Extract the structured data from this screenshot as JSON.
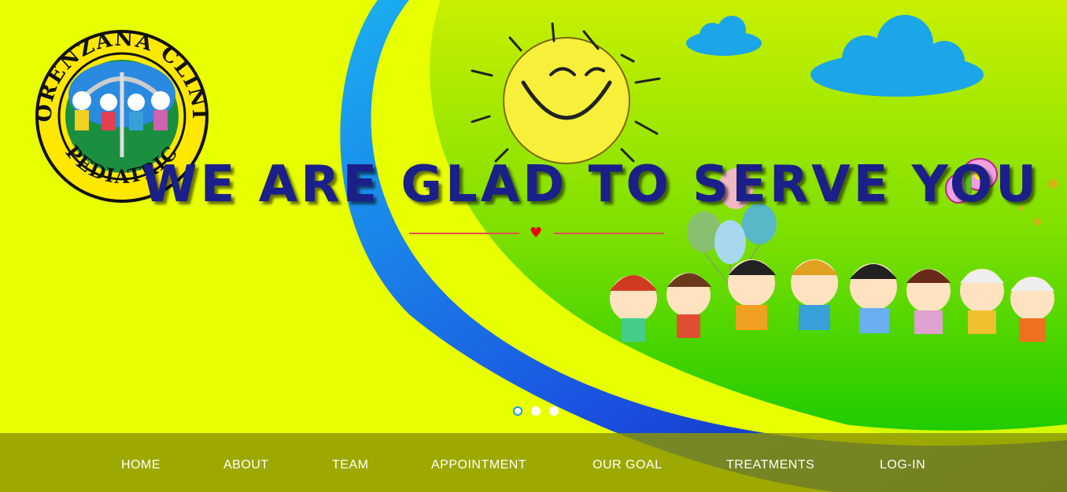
{
  "hero": {
    "headline": "WE ARE GLAD TO SERVE YOU",
    "logo": {
      "ring_text_top": "LORENZANA CLINIC",
      "ring_text_bottom": "PEDIATRIC"
    },
    "slider": {
      "slides": 3,
      "active_index": 0
    }
  },
  "nav": {
    "items": [
      {
        "label": "HOME"
      },
      {
        "label": "ABOUT"
      },
      {
        "label": "TEAM"
      },
      {
        "label": "APPOINTMENT"
      },
      {
        "label": "OUR GOAL"
      },
      {
        "label": "TREATMENTS"
      },
      {
        "label": "LOG-IN"
      }
    ]
  },
  "colors": {
    "background_yellow": "#e8ff00",
    "green_field": "#22cc00",
    "wave_blue": "#1a4fd8",
    "headline_navy": "#1b1f8a",
    "nav_bar": "#8c9600",
    "divider_red": "#e05050"
  }
}
